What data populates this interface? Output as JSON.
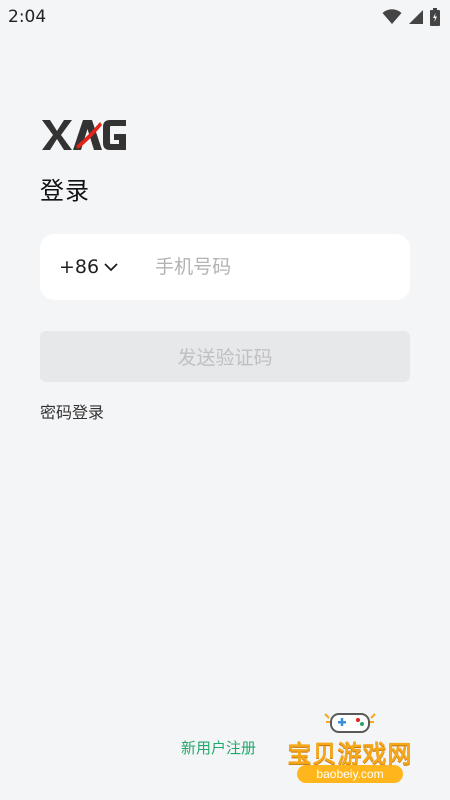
{
  "status_bar": {
    "time": "2:04",
    "icons": [
      "wifi-icon",
      "signal-icon",
      "battery-icon"
    ]
  },
  "brand": {
    "logo_text": "XAG",
    "logo_colors": {
      "text": "#333333",
      "accent": "#e1251b"
    }
  },
  "page": {
    "title": "登录"
  },
  "phone_form": {
    "country_code": "+86",
    "phone_placeholder": "手机号码",
    "phone_value": ""
  },
  "send_code_button": {
    "label": "发送验证码"
  },
  "password_login": {
    "label": "密码登录"
  },
  "register": {
    "label": "新用户注册"
  },
  "watermark": {
    "title": "宝贝游戏网",
    "domain": "baobeiy.com"
  },
  "colors": {
    "background": "#f4f5f7",
    "register_link": "#22a86b",
    "button_disabled_bg": "#e7e8ea",
    "button_disabled_text": "#c0c0c0"
  }
}
